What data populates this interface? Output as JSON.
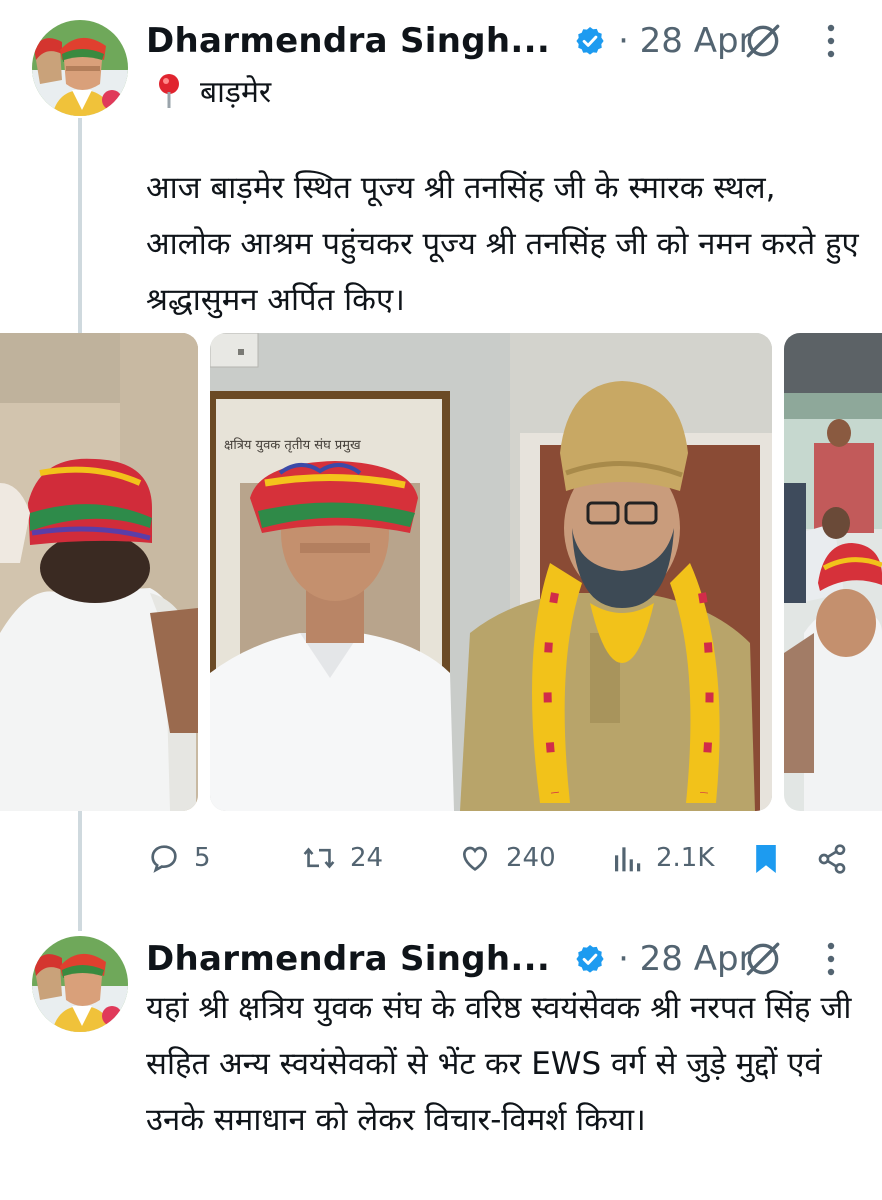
{
  "tweets": [
    {
      "author": "Dharmendra Singh...",
      "date": "· 28 Apr",
      "location_label": "बाड़मेर",
      "text": "आज बाड़मेर स्थित पूज्य श्री तनसिंह जी के स्मारक स्थल, आलोक आश्रम पहुंचकर पूज्य श्री तनसिंह जी को नमन करते हुए श्रद्धासुमन अर्पित किए।",
      "photo_caption": "क्षत्रिय युवक तृतीय संघ प्रमुख",
      "actions": {
        "replies": "5",
        "reposts": "24",
        "likes": "240",
        "views": "2.1K"
      }
    },
    {
      "author": "Dharmendra Singh...",
      "date": "· 28 Apr",
      "text": "यहां श्री क्षत्रिय युवक संघ के वरिष्ठ स्वयंसेवक श्री नरपत सिंह जी सहित अन्य स्वयंसेवकों से भेंट कर EWS वर्ग से जुड़े मुद्दों एवं उनके समाधान को लेकर विचार-विमर्श किया।"
    }
  ],
  "icons": {
    "verified": "verified-badge-icon",
    "grok": "grok-icon",
    "more": "more-vertical-icon",
    "location": "location-pin-icon",
    "reply": "reply-icon",
    "repost": "repost-icon",
    "like": "like-icon",
    "views": "views-icon",
    "bookmark": "bookmark-icon",
    "share": "share-icon"
  },
  "colors": {
    "accent": "#1d9bf0",
    "text": "#0f1419",
    "muted": "#536471",
    "line": "#cfd9de"
  }
}
